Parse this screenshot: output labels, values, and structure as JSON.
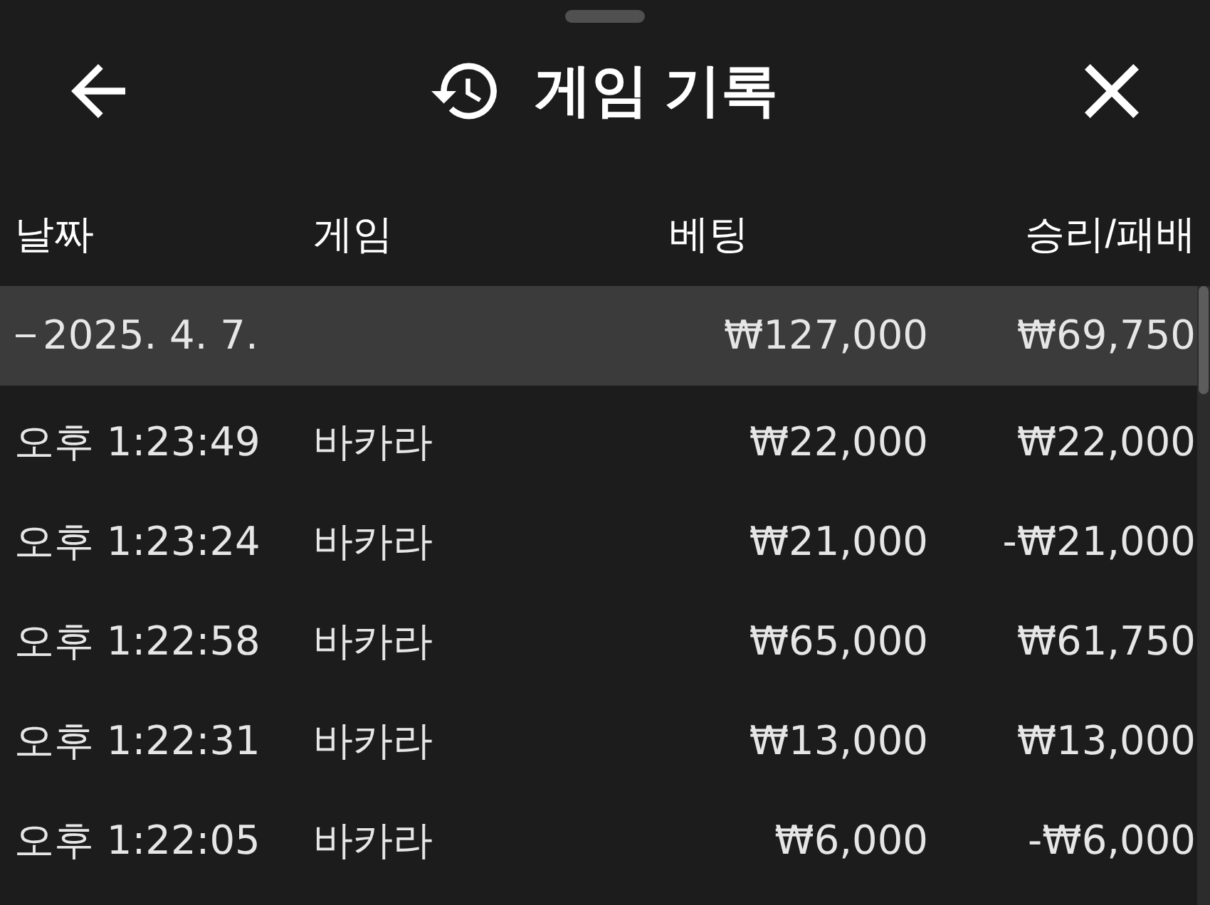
{
  "header": {
    "title": "게임 기록"
  },
  "table": {
    "columns": [
      "날짜",
      "게임",
      "베팅",
      "승리/패배"
    ],
    "groups": [
      {
        "date": "2025. 4. 7.",
        "expanded": true,
        "bet": "₩127,000",
        "result": "₩69,750",
        "children": [
          {
            "time": "오후 1:23:49",
            "game": "바카라",
            "bet": "₩22,000",
            "result": "₩22,000"
          },
          {
            "time": "오후 1:23:24",
            "game": "바카라",
            "bet": "₩21,000",
            "result": "-₩21,000"
          },
          {
            "time": "오후 1:22:58",
            "game": "바카라",
            "bet": "₩65,000",
            "result": "₩61,750"
          },
          {
            "time": "오후 1:22:31",
            "game": "바카라",
            "bet": "₩13,000",
            "result": "₩13,000"
          },
          {
            "time": "오후 1:22:05",
            "game": "바카라",
            "bet": "₩6,000",
            "result": "-₩6,000"
          }
        ]
      }
    ]
  }
}
